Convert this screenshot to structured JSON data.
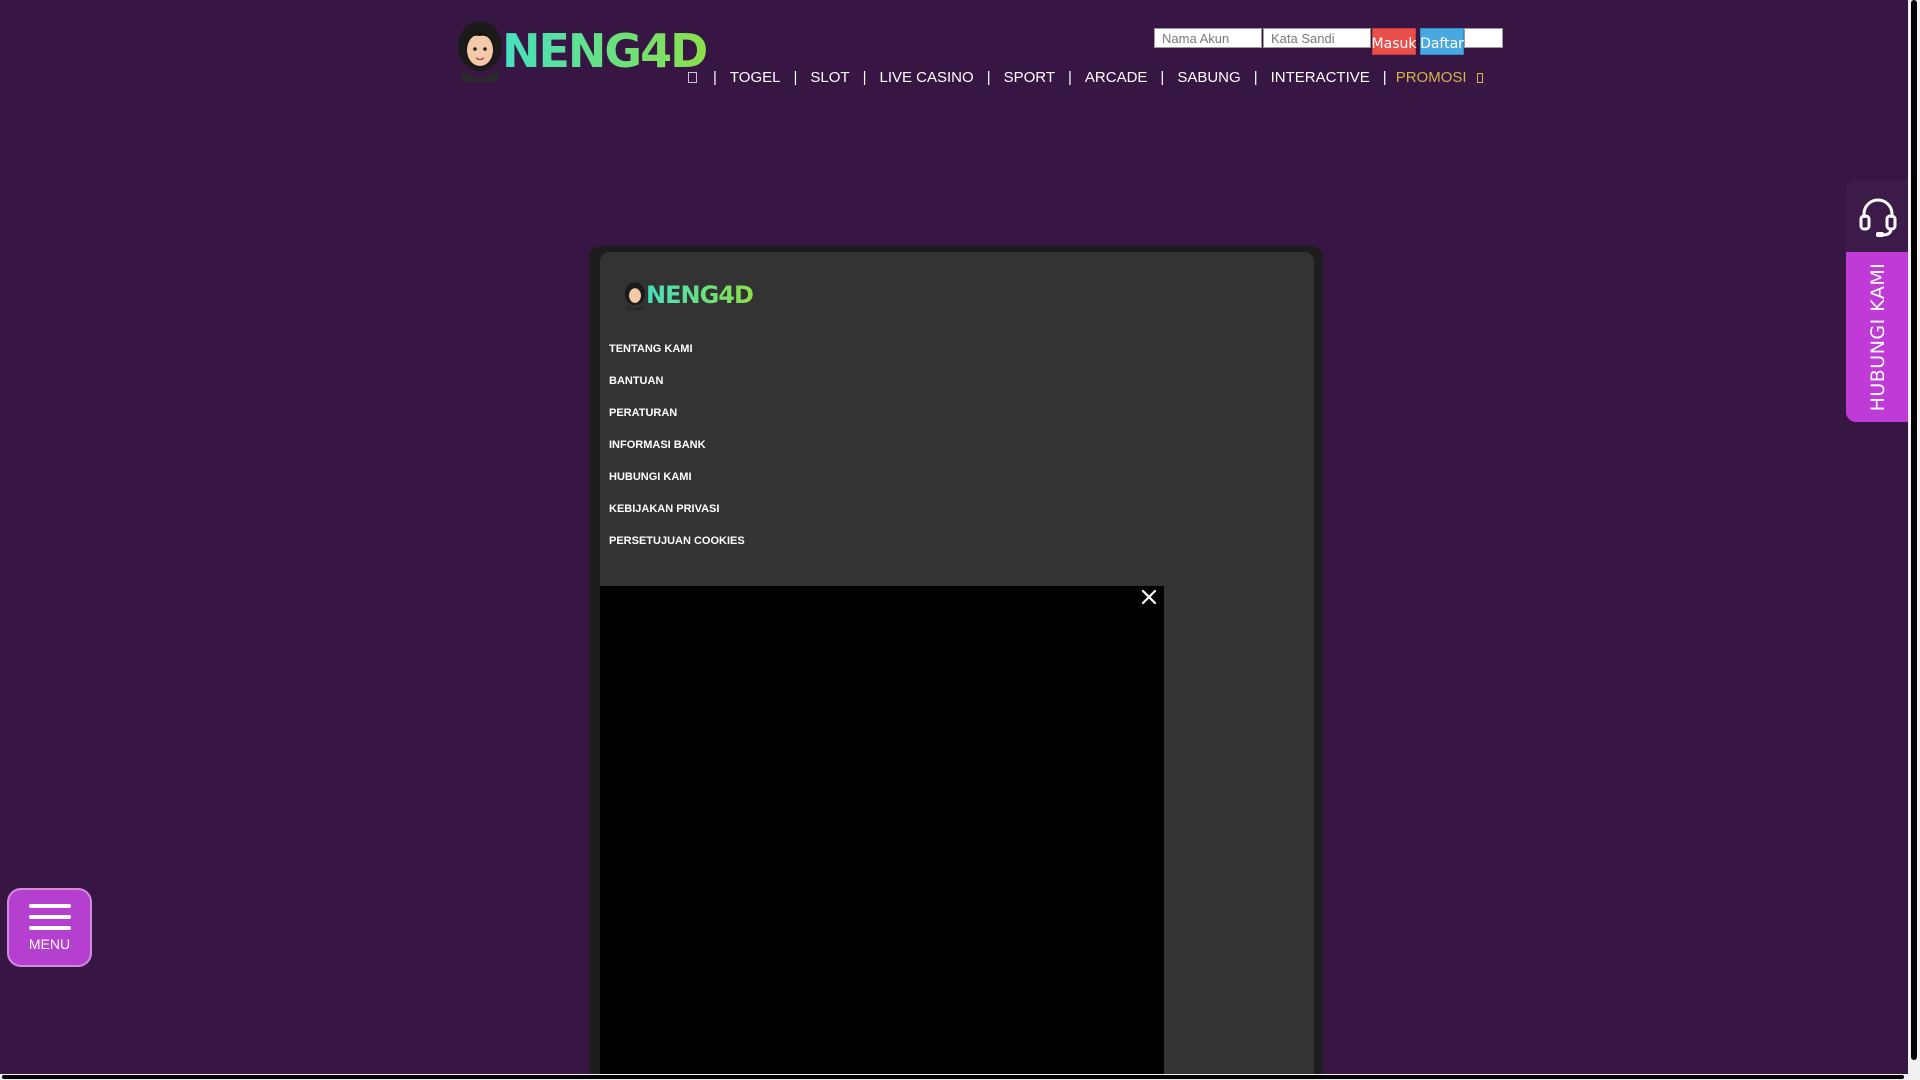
{
  "brand": {
    "logo_text": "NENG4D",
    "accent": "#b540cf",
    "background": "#371643"
  },
  "login": {
    "username_placeholder": "Nama Akun",
    "password_placeholder": "Kata Sandi",
    "login_label": "Masuk",
    "register_label": "Daftar"
  },
  "nav": {
    "items": [
      "TOGEL",
      "SLOT",
      "LIVE CASINO",
      "SPORT",
      "ARCADE",
      "SABUNG",
      "INTERACTIVE"
    ],
    "promo": "PROMOSI"
  },
  "panel": {
    "logo_text": "NENG4D",
    "links": [
      "TENTANG KAMI",
      "BANTUAN",
      "PERATURAN",
      "INFORMASI BANK",
      "HUBUNGI KAMI",
      "KEBIJAKAN PRIVASI",
      "PERSETUJUAN COOKIES"
    ]
  },
  "support": {
    "label": "HUBUNGI KAMI",
    "icon": "headset-icon"
  },
  "menu": {
    "label": "MENU",
    "icon": "hamburger-icon"
  }
}
